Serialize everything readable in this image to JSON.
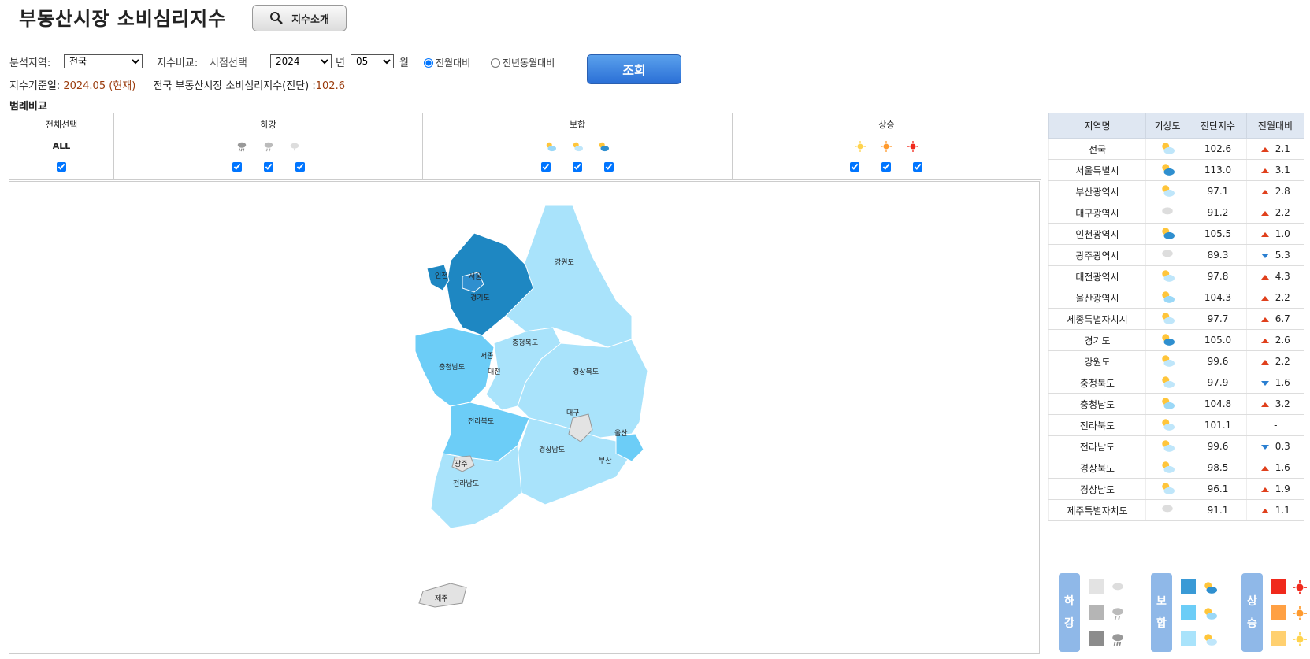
{
  "header": {
    "title": "부동산시장 소비심리지수",
    "intro_button": "지수소개"
  },
  "filters": {
    "region_label": "분석지역:",
    "region_value": "전국",
    "compare_label": "지수비교:",
    "point_label": "시점선택",
    "year_value": "2024",
    "year_unit": "년",
    "month_value": "05",
    "month_unit": "월",
    "radio_mom": "전월대비",
    "radio_yoy": "전년동월대비",
    "query_button": "조회"
  },
  "info": {
    "base_date_label": "지수기준일:",
    "base_date_value": "2024.05 (현재)",
    "summary_label": "전국 부동산시장 소비심리지수(진단) :",
    "summary_value": "102.6"
  },
  "legend_compare": {
    "section_title": "범례비교",
    "col_all": "전체선택",
    "col_down": "하강",
    "col_stable": "보합",
    "col_up": "상승",
    "all_label": "ALL"
  },
  "map": {
    "labels": [
      "인천",
      "서울",
      "경기도",
      "강원도",
      "충청북도",
      "서종",
      "대전",
      "충청남도",
      "경상북도",
      "대구",
      "전라북도",
      "울산",
      "경상남도",
      "부산",
      "광주",
      "전라남도",
      "제주"
    ]
  },
  "table": {
    "headers": [
      "지역명",
      "기상도",
      "진단지수",
      "전월대비"
    ],
    "rows": [
      {
        "name": "전국",
        "idx": "102.6",
        "dir": "up",
        "chg": "2.1",
        "wx": "stable-3"
      },
      {
        "name": "서울특별시",
        "idx": "113.0",
        "dir": "up",
        "chg": "3.1",
        "wx": "stable-1"
      },
      {
        "name": "부산광역시",
        "idx": "97.1",
        "dir": "up",
        "chg": "2.8",
        "wx": "stable-3"
      },
      {
        "name": "대구광역시",
        "idx": "91.2",
        "dir": "up",
        "chg": "2.2",
        "wx": "down-1"
      },
      {
        "name": "인천광역시",
        "idx": "105.5",
        "dir": "up",
        "chg": "1.0",
        "wx": "stable-1"
      },
      {
        "name": "광주광역시",
        "idx": "89.3",
        "dir": "down",
        "chg": "5.3",
        "wx": "down-1"
      },
      {
        "name": "대전광역시",
        "idx": "97.8",
        "dir": "up",
        "chg": "4.3",
        "wx": "stable-3"
      },
      {
        "name": "울산광역시",
        "idx": "104.3",
        "dir": "up",
        "chg": "2.2",
        "wx": "stable-2"
      },
      {
        "name": "세종특별자치시",
        "idx": "97.7",
        "dir": "up",
        "chg": "6.7",
        "wx": "stable-3"
      },
      {
        "name": "경기도",
        "idx": "105.0",
        "dir": "up",
        "chg": "2.6",
        "wx": "stable-1"
      },
      {
        "name": "강원도",
        "idx": "99.6",
        "dir": "up",
        "chg": "2.2",
        "wx": "stable-3"
      },
      {
        "name": "충청북도",
        "idx": "97.9",
        "dir": "down",
        "chg": "1.6",
        "wx": "stable-3"
      },
      {
        "name": "충청남도",
        "idx": "104.8",
        "dir": "up",
        "chg": "3.2",
        "wx": "stable-2"
      },
      {
        "name": "전라북도",
        "idx": "101.1",
        "dir": "none",
        "chg": "-",
        "wx": "stable-3"
      },
      {
        "name": "전라남도",
        "idx": "99.6",
        "dir": "down",
        "chg": "0.3",
        "wx": "stable-3"
      },
      {
        "name": "경상북도",
        "idx": "98.5",
        "dir": "up",
        "chg": "1.6",
        "wx": "stable-3"
      },
      {
        "name": "경상남도",
        "idx": "96.1",
        "dir": "up",
        "chg": "1.9",
        "wx": "stable-3"
      },
      {
        "name": "제주특별자치도",
        "idx": "91.1",
        "dir": "up",
        "chg": "1.1",
        "wx": "down-1"
      }
    ]
  },
  "color_legend": {
    "down": [
      "하",
      "강"
    ],
    "stable": [
      "보",
      "합"
    ],
    "up": [
      "상",
      "승"
    ],
    "colors": {
      "down": [
        "#e3e3e3",
        "#b5b5b5",
        "#8c8c8c"
      ],
      "stable": [
        "#3a9ad6",
        "#6ccdf7",
        "#a9e3fb"
      ],
      "up": [
        "#f0291c",
        "#ffa043",
        "#ffd070"
      ]
    }
  }
}
